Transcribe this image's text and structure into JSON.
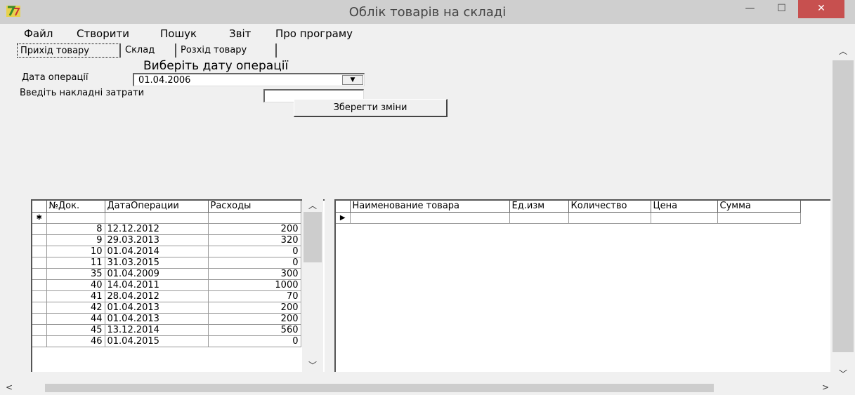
{
  "window": {
    "title": "Облік товарів на складі",
    "icon": "app-logo-icon",
    "controls": {
      "minimize": "—",
      "maximize": "☐",
      "close": "✕"
    }
  },
  "menu": [
    "Файл",
    "Створити",
    "Пошук",
    "Звіт",
    "Про програму"
  ],
  "tabs": [
    "Прихід товару",
    "Склад",
    "Розхід товару"
  ],
  "form": {
    "date_hint": "Виберіть дату операції",
    "date_label": "Дата операції",
    "date_value": "01.04.2006",
    "costs_label": "Введіть накладні затрати",
    "costs_value": "",
    "save_label": "Зберегти зміни"
  },
  "documents_grid": {
    "columns": [
      "№Док.",
      "ДатаОперации",
      "Расходы"
    ],
    "new_row_marker": "✱",
    "rows": [
      [
        "8",
        "12.12.2012",
        "200"
      ],
      [
        "9",
        "29.03.2013",
        "320"
      ],
      [
        "10",
        "01.04.2014",
        "0"
      ],
      [
        "11",
        "31.03.2015",
        "0"
      ],
      [
        "35",
        "01.04.2009",
        "300"
      ],
      [
        "40",
        "14.04.2011",
        "1000"
      ],
      [
        "41",
        "28.04.2012",
        "70"
      ],
      [
        "42",
        "01.04.2013",
        "200"
      ],
      [
        "44",
        "01.04.2013",
        "200"
      ],
      [
        "45",
        "13.12.2014",
        "560"
      ],
      [
        "46",
        "01.04.2015",
        "0"
      ]
    ]
  },
  "items_grid": {
    "columns": [
      "Наименование товара",
      "Ед.изм",
      "Количество",
      "Цена",
      "Сумма"
    ],
    "current_row_marker": "▶"
  },
  "scroll": {
    "up": "︿",
    "down": "﹀",
    "left": "<",
    "right": ">"
  }
}
